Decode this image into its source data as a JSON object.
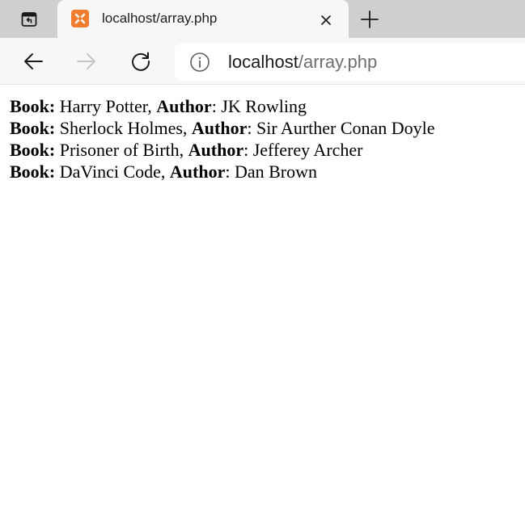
{
  "tab": {
    "title": "localhost/array.php",
    "favicon": "xampp-icon"
  },
  "addressbar": {
    "host": "localhost",
    "path": "/array.php"
  },
  "page": {
    "book_label": "Book:",
    "author_label": "Author",
    "rows": [
      {
        "book": " Harry Potter, ",
        "author": ": JK Rowling"
      },
      {
        "book": " Sherlock Holmes, ",
        "author": ": Sir Aurther Conan Doyle"
      },
      {
        "book": " Prisoner of Birth, ",
        "author": ": Jefferey Archer"
      },
      {
        "book": " DaVinci Code, ",
        "author": ": Dan Brown"
      }
    ]
  },
  "colors": {
    "tabstrip": "#cfcfcf",
    "toolbar": "#f7f7f7",
    "favicon": "#ef7d2d",
    "url_path": "#6f6f6f"
  }
}
